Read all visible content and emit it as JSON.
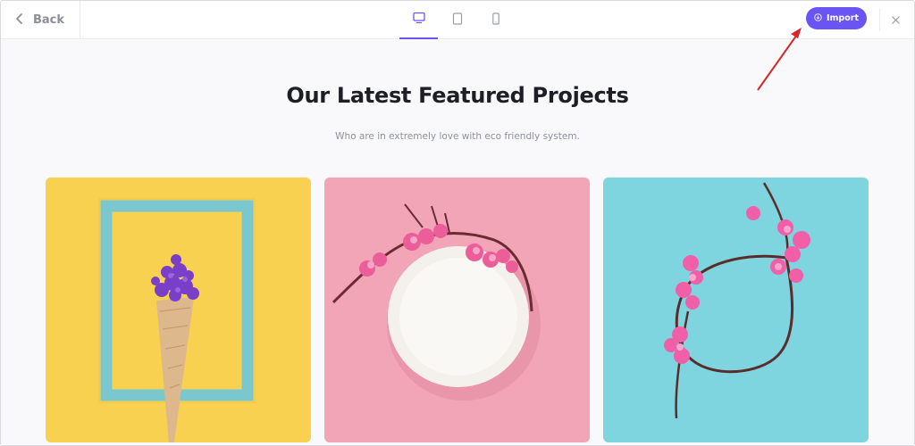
{
  "toolbar": {
    "back_label": "Back",
    "devices": [
      "desktop-icon",
      "tablet-icon",
      "mobile-icon"
    ],
    "active_device": "desktop",
    "import_label": "Import",
    "accent_color": "#6a55f4"
  },
  "main": {
    "heading": "Our Latest Featured Projects",
    "subheading": "Who are in extremely love with eco friendly system."
  },
  "cards": [
    {
      "background": "#f7d14f",
      "subject": "flowers-in-cone-frame"
    },
    {
      "background": "#f2a5b7",
      "subject": "plate-with-blossom-branch"
    },
    {
      "background": "#7ed4df",
      "subject": "blossom-branch-circle"
    }
  ],
  "annotation": {
    "arrow_color": "#d7262b"
  }
}
